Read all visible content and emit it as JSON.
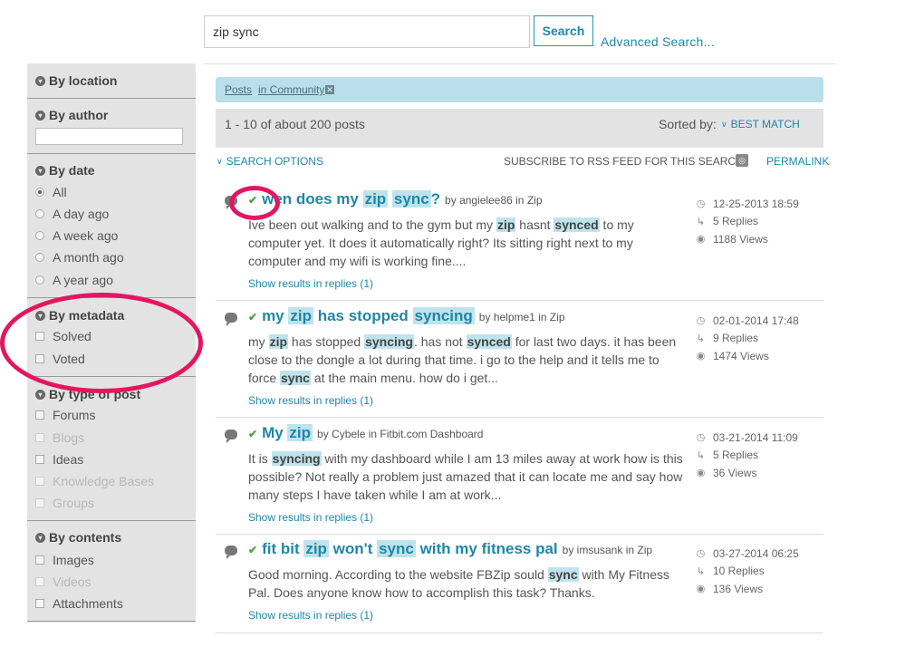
{
  "search": {
    "query": "zip sync",
    "button_label": "Search",
    "advanced_label": "Advanced Search..."
  },
  "sidebar": {
    "location": {
      "label": "By location"
    },
    "author": {
      "label": "By author"
    },
    "date": {
      "label": "By date",
      "options": [
        "All",
        "A day ago",
        "A week ago",
        "A month ago",
        "A year ago"
      ],
      "selected": "All"
    },
    "metadata": {
      "label": "By metadata",
      "options": [
        "Solved",
        "Voted"
      ]
    },
    "type": {
      "label": "By type of post",
      "options": [
        "Forums",
        "Blogs",
        "Ideas",
        "Knowledge Bases",
        "Groups"
      ]
    },
    "contents": {
      "label": "By contents",
      "options": [
        "Images",
        "Videos",
        "Attachments"
      ]
    }
  },
  "filters": {
    "posts_label": "Posts",
    "community_label": "in Community",
    "close_icon": "close-icon"
  },
  "results": {
    "count_label": "1 - 10 of about 200 posts",
    "sorted_by_label": "Sorted by:",
    "sort_value": "BEST MATCH",
    "search_options_label": "SEARCH OPTIONS",
    "rss_label": "SUBSCRIBE TO RSS FEED FOR THIS SEARCH",
    "permalink_label": "PERMALINK"
  },
  "posts": [
    {
      "title": [
        "w",
        "en does my ",
        "zip",
        " ",
        "sync",
        "?"
      ],
      "author": "angielee86",
      "in_word": "in",
      "board": "Zip",
      "excerpt": [
        "Ive been out walking and to the gym but my ",
        "zip",
        " hasnt ",
        "synced",
        " to my computer yet. It does it automatically right? Its sitting right next to my computer and my wifi is working fine...."
      ],
      "replies_link": "Show results in replies (1)",
      "date": "12-25-2013 18:59",
      "replies": "5 Replies",
      "views": "1188 Views"
    },
    {
      "title": [
        "my ",
        "zip",
        " has stopped ",
        "syncing"
      ],
      "author": "helpme1",
      "in_word": "in",
      "board": "Zip",
      "excerpt": [
        "my ",
        "zip",
        " has stopped ",
        "syncing",
        ".  has not ",
        "synced",
        " for last two days.  it has been close to the dongle a lot during that time.  i go to the help and it tells me to force ",
        "sync",
        " at the main menu.  how do i get..."
      ],
      "replies_link": "Show results in replies (1)",
      "date": "02-01-2014 17:48",
      "replies": "9 Replies",
      "views": "1474 Views"
    },
    {
      "title": [
        "My ",
        "zip"
      ],
      "author": "Cybele",
      "in_word": "in",
      "board": "Fitbit.com Dashboard",
      "excerpt": [
        "It is ",
        "syncing",
        " with my dashboard while I am 13 miles away at work how is this possible?   Not really a problem just amazed that it can locate me and say how many steps I have taken while I am at work..."
      ],
      "replies_link": "Show results in replies (1)",
      "date": "03-21-2014 11:09",
      "replies": "5 Replies",
      "views": "36 Views"
    },
    {
      "title": [
        "fit bit ",
        "zip",
        " won't ",
        "sync",
        " with my fitness pal"
      ],
      "author": "imsusank",
      "in_word": "in",
      "board": "Zip",
      "excerpt": [
        "Good morning.  According to the website FBZip sould ",
        "sync",
        " with My Fitness Pal. Does anyone know how to accomplish this task?  Thanks."
      ],
      "replies_link": "Show results in replies (1)",
      "date": "03-27-2014 06:25",
      "replies": "10 Replies",
      "views": "136 Views"
    }
  ],
  "colors": {
    "accent": "#1e87a8",
    "highlight": "#bfe3ec",
    "annotation": "#e3165f",
    "sidebar": "#e3e3e3"
  },
  "icons": {
    "section": "chevron-down-circle-icon",
    "check": "check-icon",
    "bubble": "speech-bubble-icon",
    "clock": "clock-icon",
    "reply": "reply-arrow-icon",
    "eye": "eye-icon",
    "rss": "rss-icon"
  }
}
